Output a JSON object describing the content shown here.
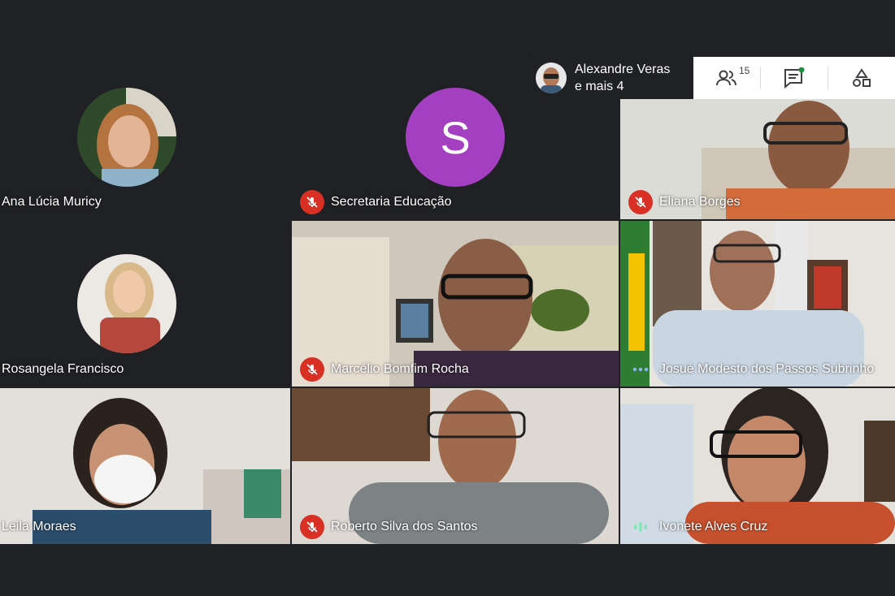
{
  "participants": [
    {
      "name": "Ana Lúcia Muricy"
    },
    {
      "name": "Secretaria Educação",
      "initial": "S"
    },
    {
      "name": "Eliana Borges"
    },
    {
      "name": "Rosangela Francisco"
    },
    {
      "name": "Marcélio Bomfim Rocha"
    },
    {
      "name": "Josué Modesto dos Passos Subrinho"
    },
    {
      "name": "Leila Moraes"
    },
    {
      "name": "Roberto Silva dos Santos"
    },
    {
      "name": "Ivonete Alves Cruz"
    }
  ],
  "others": {
    "line1": "Alexandre Veras",
    "line2": "e mais 4"
  },
  "toolbar": {
    "people_count": "15"
  },
  "colors": {
    "background": "#202124",
    "mute_red": "#d93025",
    "avatar_purple": "#a53fc1",
    "chat_badge": "#1e8e3e"
  },
  "icons": [
    "mic-off-icon",
    "people-icon",
    "chat-icon",
    "activities-icon",
    "speaking-dots-icon"
  ]
}
